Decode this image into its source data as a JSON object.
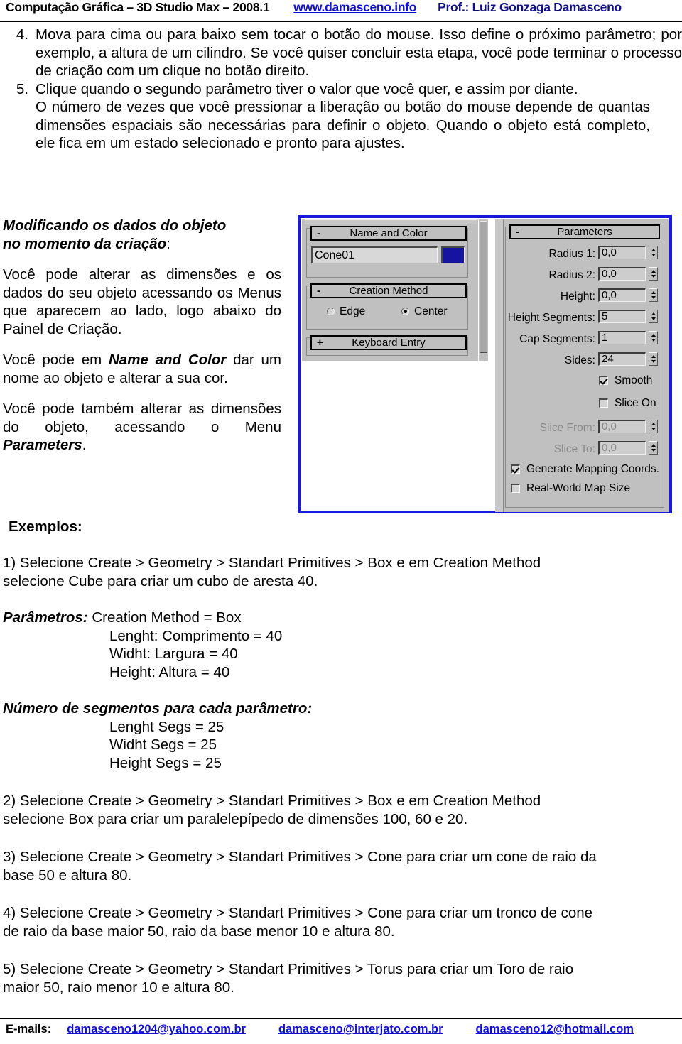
{
  "header": {
    "title": "Computação Gráfica – 3D Studio Max – 2008.1",
    "link": "www.damasceno.info",
    "professor": "Prof.: Luiz Gonzaga Damasceno"
  },
  "steps": [
    {
      "num": "4.",
      "text": "Mova para cima ou para baixo sem tocar o botão do mouse. Isso define o próximo parâmetro; por exemplo, a altura de um cilindro. Se você quiser concluir esta etapa, você pode terminar o processo de criação com um clique no botão direito."
    },
    {
      "num": "5.",
      "text": "Clique quando o segundo parâmetro tiver o valor que você quer, e assim por diante."
    }
  ],
  "after_steps_paragraph": "O número de vezes que você pressionar a liberação ou botão do mouse depende de quantas dimensões espaciais são necessárias para definir o objeto. Quando o objeto está completo, ele fica em um estado selecionado e pronto para ajustes.",
  "left_column": {
    "heading_line1": "Modificando os dados do objeto",
    "heading_line2": "no momento da criação",
    "heading_colon": ":",
    "p1": "Você pode alterar as dimensões e os dados do seu objeto acessando os Menus que aparecem ao lado, logo abaixo do Painel de Criação.",
    "p2_before": "Você pode em ",
    "p2_bold": "Name and Color",
    "p2_after": " dar um nome ao objeto e alterar a sua cor.",
    "p3_before": "Você pode também alterar as dimensões do objeto, acessando o Menu ",
    "p3_bold": "Parameters",
    "p3_after": "."
  },
  "max_ui": {
    "name_and_color": {
      "rollout_label": "Name and Color",
      "toggle": "-",
      "object_name": "Cone01",
      "color_swatch": "#1414a0"
    },
    "creation_method": {
      "rollout_label": "Creation Method",
      "toggle": "-",
      "options": [
        {
          "label": "Edge",
          "selected": false
        },
        {
          "label": "Center",
          "selected": true
        }
      ]
    },
    "keyboard_entry": {
      "rollout_label": "Keyboard Entry",
      "toggle": "+"
    },
    "parameters": {
      "rollout_label": "Parameters",
      "toggle": "-",
      "fields": [
        {
          "label": "Radius 1:",
          "value": "0,0",
          "disabled": false
        },
        {
          "label": "Radius 2:",
          "value": "0,0",
          "disabled": false
        },
        {
          "label": "Height:",
          "value": "0,0",
          "disabled": false
        },
        {
          "label": "Height Segments:",
          "value": "5",
          "disabled": false
        },
        {
          "label": "Cap Segments:",
          "value": "1",
          "disabled": false
        },
        {
          "label": "Sides:",
          "value": "24",
          "disabled": false
        }
      ],
      "checks": [
        {
          "label": "Smooth",
          "checked": true
        },
        {
          "label": "Slice On",
          "checked": false
        }
      ],
      "slice_fields": [
        {
          "label": "Slice From:",
          "value": "0,0",
          "disabled": true
        },
        {
          "label": "Slice To:",
          "value": "0,0",
          "disabled": true
        }
      ],
      "bottom_checks": [
        {
          "label": "Generate Mapping Coords.",
          "checked": true
        },
        {
          "label": "Real-World Map Size",
          "checked": false
        }
      ]
    }
  },
  "examples": {
    "heading": "Exemplos:",
    "item1_line1": "1) Selecione Create > Geometry > Standart Primitives > Box e em Creation Method",
    "item1_line2": "selecione Cube para criar um cubo de aresta 40.",
    "params_label": "Parâmetros:",
    "params_first": " Creation Method = Box",
    "params_rows": [
      "Lenght: Comprimento = 40",
      "Widht: Largura = 40",
      "Height: Altura = 40"
    ],
    "segments_heading": "Número de segmentos para cada parâmetro:",
    "segments_rows": [
      "Lenght Segs = 25",
      "Widht Segs = 25",
      "Height Segs  = 25"
    ],
    "item2_line1": "2) Selecione Create > Geometry > Standart Primitives > Box e em Creation Method",
    "item2_line2": "selecione Box para criar um paralelepípedo de dimensões 100, 60 e 20.",
    "item3_line1": "3) Selecione Create > Geometry > Standart Primitives > Cone para criar um cone de raio da",
    "item3_line2": "base 50 e altura 80.",
    "item4_line1": "4) Selecione Create > Geometry > Standart Primitives > Cone para criar um tronco de cone",
    "item4_line2": "de raio da base maior 50, raio da base menor 10 e altura 80.",
    "item5_line1": "5) Selecione Create > Geometry > Standart Primitives > Torus para criar um Toro de raio",
    "item5_line2": "maior 50, raio menor 10 e altura 80."
  },
  "footer": {
    "label": "E-mails:",
    "emails": [
      "damasceno1204@yahoo.com.br",
      "damasceno@interjato.com.br",
      "damasceno12@hotmail.com"
    ]
  }
}
